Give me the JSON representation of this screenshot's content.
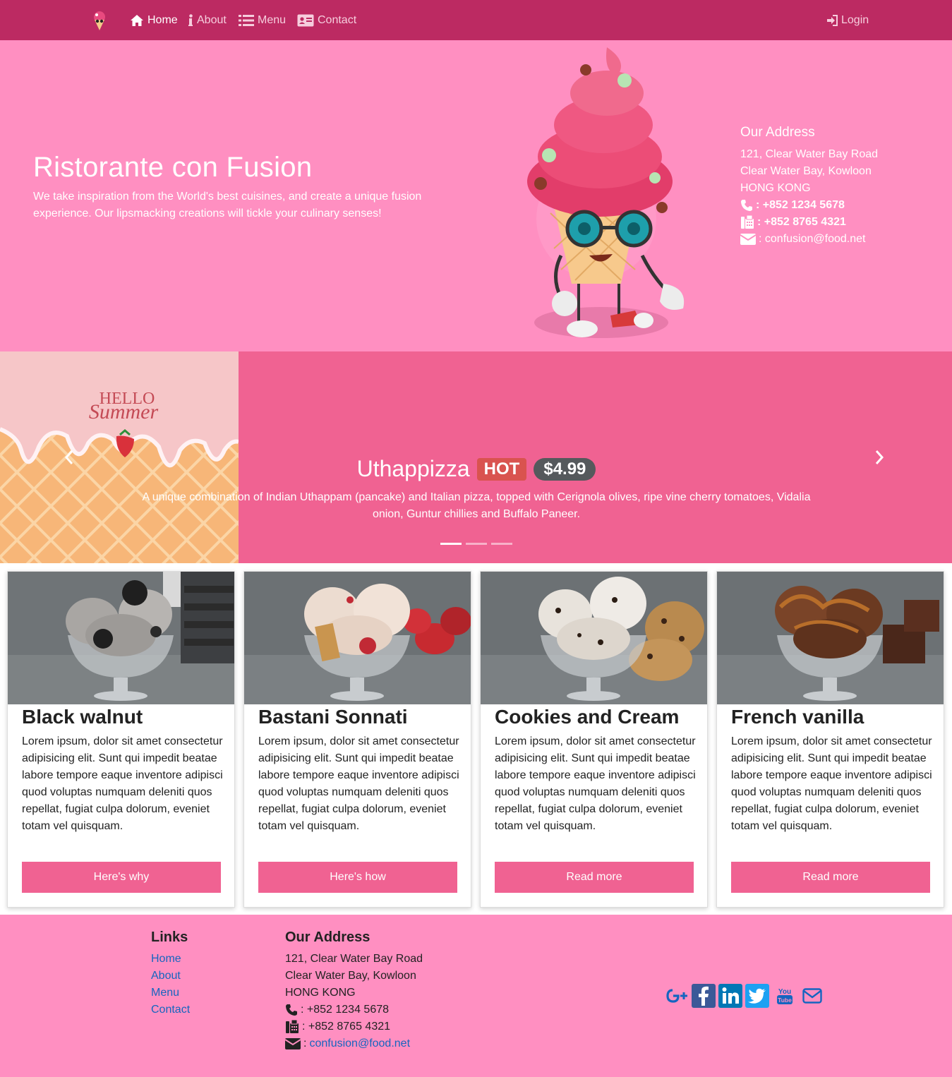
{
  "nav": {
    "home": "Home",
    "about": "About",
    "menu": "Menu",
    "contact": "Contact",
    "login": "Login"
  },
  "jumbotron": {
    "title": "Ristorante con Fusion",
    "text": "We take inspiration from the World's best cuisines, and create a unique fusion experience. Our lipsmacking creations will tickle your culinary senses!",
    "address_heading": "Our Address",
    "address_line1": "121, Clear Water Bay Road",
    "address_line2": "Clear Water Bay, Kowloon",
    "address_line3": "HONG KONG",
    "phone": ": +852 1234 5678",
    "fax": ": +852 8765 4321",
    "email": ": confusion@food.net"
  },
  "carousel": {
    "title": "Uthappizza",
    "badge_hot": "HOT",
    "price": "$4.99",
    "description": "A unique combination of Indian Uthappam (pancake) and Italian pizza, topped with Cerignola olives, ripe vine cherry tomatoes, Vidalia onion, Guntur chillies and Buffalo Paneer.",
    "image_text_hello": "HELLO",
    "image_text_summer": "Summer",
    "indicators": 3,
    "active_indicator": 0
  },
  "cards": [
    {
      "title": "Black walnut",
      "text": "Lorem ipsum, dolor sit amet consectetur adipisicing elit. Sunt qui impedit beatae labore tempore eaque inventore adipisci quod voluptas numquam deleniti quos repellat, fugiat culpa dolorum, eveniet totam vel quisquam.",
      "button": "Here's why"
    },
    {
      "title": "Bastani Sonnati",
      "text": "Lorem ipsum, dolor sit amet consectetur adipisicing elit. Sunt qui impedit beatae labore tempore eaque inventore adipisci quod voluptas numquam deleniti quos repellat, fugiat culpa dolorum, eveniet totam vel quisquam.",
      "button": "Here's how"
    },
    {
      "title": "Cookies and Cream",
      "text": "Lorem ipsum, dolor sit amet consectetur adipisicing elit. Sunt qui impedit beatae labore tempore eaque inventore adipisci quod voluptas numquam deleniti quos repellat, fugiat culpa dolorum, eveniet totam vel quisquam.",
      "button": "Read more"
    },
    {
      "title": "French vanilla",
      "text": "Lorem ipsum, dolor sit amet consectetur adipisicing elit. Sunt qui impedit beatae labore tempore eaque inventore adipisci quod voluptas numquam deleniti quos repellat, fugiat culpa dolorum, eveniet totam vel quisquam.",
      "button": "Read more"
    }
  ],
  "footer": {
    "links_heading": "Links",
    "links": [
      "Home",
      "About",
      "Menu",
      "Contact"
    ],
    "address_heading": "Our Address",
    "address_line1": "121, Clear Water Bay Road",
    "address_line2": "Clear Water Bay, Kowloon",
    "address_line3": "HONG KONG",
    "phone": ": +852 1234 5678",
    "fax": ": +852 8765 4321",
    "email": "confusion@food.net",
    "social": [
      "google-plus-icon",
      "facebook-icon",
      "linkedin-icon",
      "twitter-icon",
      "youtube-icon",
      "mail-icon"
    ]
  },
  "colors": {
    "navbar": "#bc2a62",
    "jumbotron": "#ff8fc1",
    "carousel": "#f06292",
    "button": "#f06292",
    "link": "#1565c0"
  }
}
